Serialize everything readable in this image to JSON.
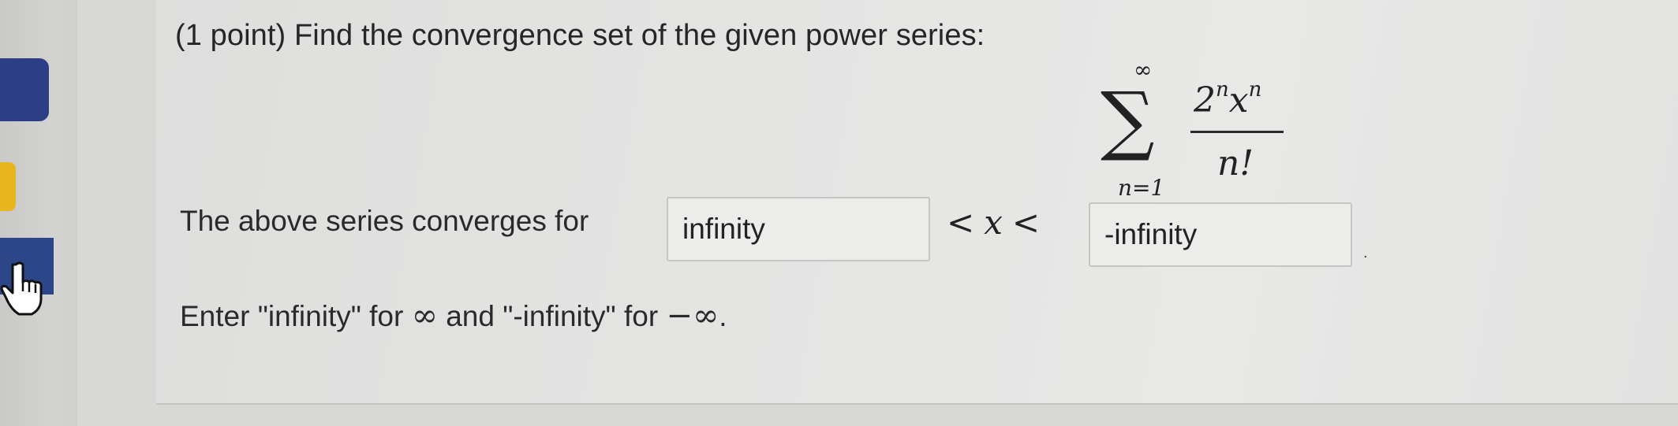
{
  "problem": {
    "title": "(1 point) Find the convergence set of the given power series:"
  },
  "formula": {
    "upper_limit": "∞",
    "lower_limit": "n=1",
    "numerator_base1": "2",
    "numerator_exp1": "n",
    "numerator_base2": "x",
    "numerator_exp2": "n",
    "denominator": "n!"
  },
  "answer": {
    "label": "The above series converges for",
    "lower_value": "infinity",
    "upper_value": "-infinity",
    "inequality_left": "<",
    "variable": "x",
    "inequality_right": "<"
  },
  "hint": {
    "part1": "Enter \"infinity\" for ",
    "inf_symbol": "∞",
    "part2": " and \"-infinity\" for ",
    "neg_inf_symbol": "−∞",
    "part3": "."
  }
}
